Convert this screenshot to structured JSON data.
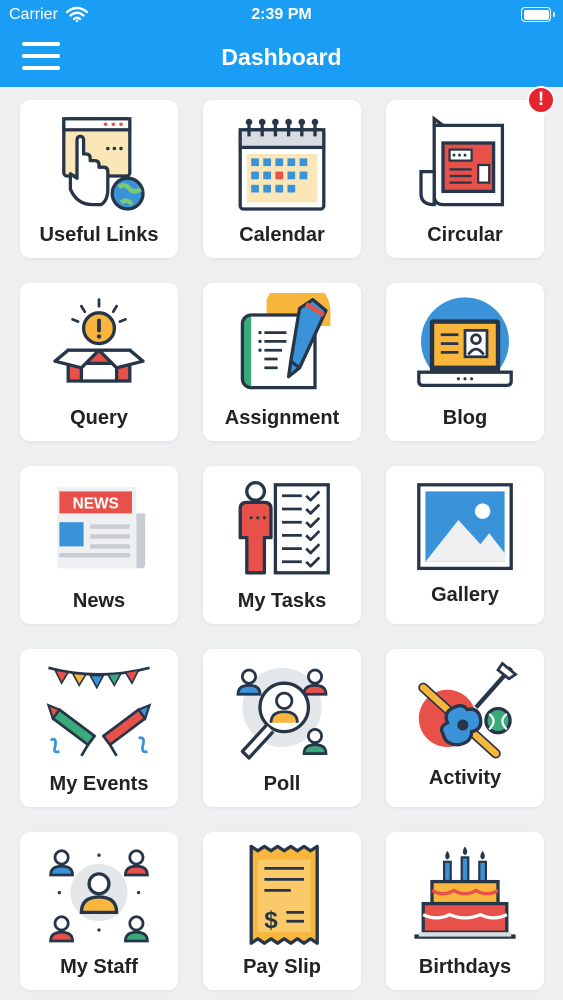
{
  "status_bar": {
    "carrier": "Carrier",
    "time": "2:39 PM"
  },
  "nav": {
    "title": "Dashboard",
    "menu_icon": "hamburger-menu-icon"
  },
  "colors": {
    "primary": "#1a9df4",
    "background": "#eeeff1",
    "badge": "#e8232e"
  },
  "tiles": [
    {
      "label": "Useful Links",
      "icon": "useful-links-icon"
    },
    {
      "label": "Calendar",
      "icon": "calendar-icon"
    },
    {
      "label": "Circular",
      "icon": "circular-icon",
      "badge": "!"
    },
    {
      "label": "Query",
      "icon": "query-icon"
    },
    {
      "label": "Assignment",
      "icon": "assignment-icon"
    },
    {
      "label": "Blog",
      "icon": "blog-icon"
    },
    {
      "label": "News",
      "icon": "news-icon",
      "icon_text": "NEWS"
    },
    {
      "label": "My Tasks",
      "icon": "my-tasks-icon"
    },
    {
      "label": "Gallery",
      "icon": "gallery-icon"
    },
    {
      "label": "My Events",
      "icon": "my-events-icon"
    },
    {
      "label": "Poll",
      "icon": "poll-icon"
    },
    {
      "label": "Activity",
      "icon": "activity-icon"
    },
    {
      "label": "My Staff",
      "icon": "my-staff-icon"
    },
    {
      "label": "Pay Slip",
      "icon": "pay-slip-icon",
      "icon_text": "$"
    },
    {
      "label": "Birthdays",
      "icon": "birthdays-icon"
    }
  ]
}
